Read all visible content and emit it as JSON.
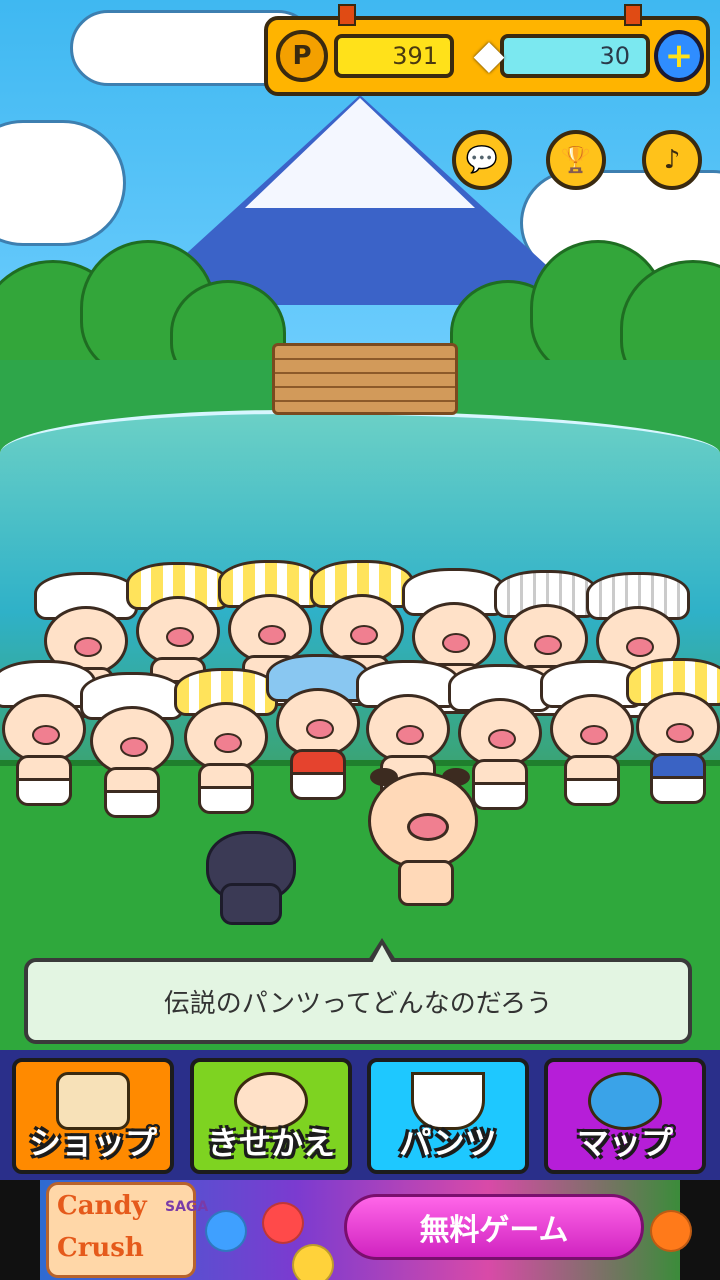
{
  "header": {
    "coins": "391",
    "gems": "30",
    "coin_symbol": "P",
    "plus": "+"
  },
  "top_buttons": [
    {
      "icon": "chat-icon"
    },
    {
      "icon": "trophy-icon"
    },
    {
      "icon": "music-note-icon"
    }
  ],
  "dialog": {
    "message": "伝説のパンツってどんなのだろう"
  },
  "nav": [
    {
      "label": "ショップ",
      "color": "#ff8a00",
      "icon": "house-icon"
    },
    {
      "label": "きせかえ",
      "color": "#7ed321",
      "icon": "pig-icon"
    },
    {
      "label": "パンツ",
      "color": "#1ec8ff",
      "icon": "pants-icon"
    },
    {
      "label": "マップ",
      "color": "#b61ed8",
      "icon": "globe-icon"
    }
  ],
  "ad": {
    "logo_line1": "Candy",
    "logo_line2": "Crush",
    "logo_saga": "SAGA",
    "cta": "無料ゲーム"
  },
  "colors": {
    "currency_bar": "#ffb400",
    "coin_field": "#ffe11a",
    "gem_field": "#7be8f0",
    "plus_button": "#2f8dff",
    "round_button": "#ffc21a",
    "speech_bg": "#e3f5e2"
  }
}
